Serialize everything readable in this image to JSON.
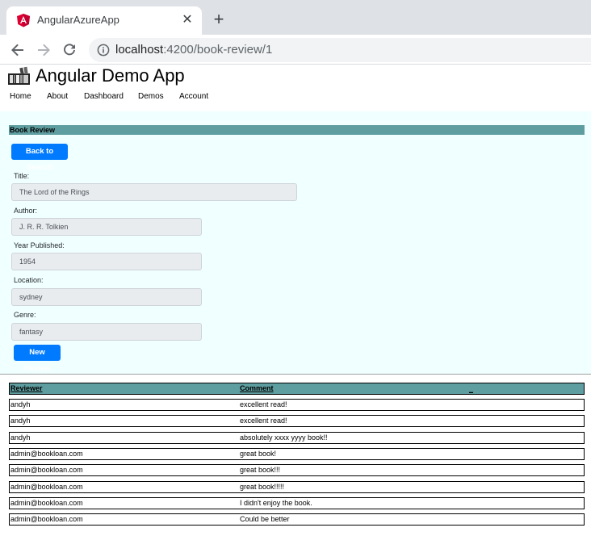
{
  "browser": {
    "tab_title": "AngularAzureApp",
    "tab_close": "✕",
    "new_tab": "+",
    "url_host": "localhost",
    "url_path": ":4200/book-review/1"
  },
  "app": {
    "title": "Angular Demo App",
    "nav": [
      "Home",
      "About",
      "Dashboard",
      "Demos",
      "Account"
    ]
  },
  "review": {
    "header": "Book Review",
    "back_button": "Back to Search",
    "fields": [
      {
        "label": "Title:",
        "value": "The Lord of the Rings"
      },
      {
        "label": "Author:",
        "value": "J. R. R. Tolkien"
      },
      {
        "label": "Year Published:",
        "value": "1954"
      },
      {
        "label": "Location:",
        "value": "sydney"
      },
      {
        "label": "Genre:",
        "value": "fantasy"
      }
    ],
    "new_review_button": "New Review"
  },
  "reviews_table": {
    "columns": [
      "Reviewer",
      "Comment",
      "_"
    ],
    "rows": [
      {
        "reviewer": "andyh",
        "comment": "excellent read!"
      },
      {
        "reviewer": "andyh",
        "comment": "excellent read!"
      },
      {
        "reviewer": "andyh",
        "comment": "absolutely xxxx yyyy book!!"
      },
      {
        "reviewer": "admin@bookloan.com",
        "comment": "great book!"
      },
      {
        "reviewer": "admin@bookloan.com",
        "comment": "great book!!!"
      },
      {
        "reviewer": "admin@bookloan.com",
        "comment": "great book!!!!!"
      },
      {
        "reviewer": "admin@bookloan.com",
        "comment": "I didn't enjoy the book."
      },
      {
        "reviewer": "admin@bookloan.com",
        "comment": "Could be better"
      }
    ]
  },
  "colors": {
    "accent": "#007bff",
    "header_band": "#5f9ea0",
    "panel_bg": "#f0ffff",
    "angular_red": "#dd0031"
  },
  "icons": {
    "favicon": "angular-shield-icon",
    "back": "arrow-left-icon",
    "forward": "arrow-right-icon",
    "reload": "reload-icon",
    "site_info": "info-circle-icon",
    "logo": "books-icon"
  }
}
